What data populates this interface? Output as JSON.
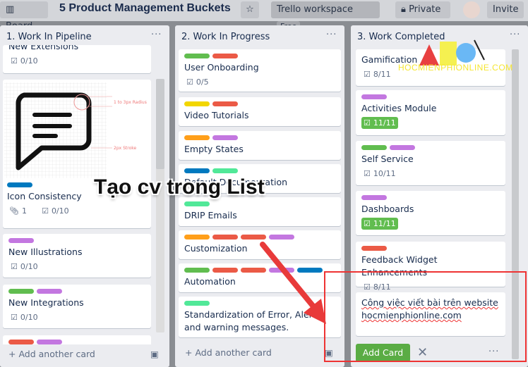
{
  "header": {
    "board_menu": "Board",
    "title": "5 Product Management Buckets",
    "workspace": "Trello workspace",
    "workspace_badge": "Free",
    "visibility": "Private",
    "invite": "Invite"
  },
  "colors": {
    "green": "#61bd4f",
    "red": "#eb5a46",
    "purple": "#c377e0",
    "blue": "#0079bf",
    "orange": "#ff9f1a",
    "yellow": "#f2d600",
    "lime": "#51e898"
  },
  "lists": [
    {
      "title": "1. Work In Pipeline",
      "add": "Add another card",
      "cards": [
        {
          "title": "New Extensions",
          "labels": [],
          "checklist": "0/10"
        },
        {
          "title": "Icon Consistency",
          "labels": [
            "blue"
          ],
          "attachments": "1",
          "checklist": "0/10",
          "cover_text": [
            "1 to 3px Radius",
            "2px Stroke"
          ]
        },
        {
          "title": "New Illustrations",
          "labels": [
            "purple"
          ],
          "checklist": "0/10"
        },
        {
          "title": "New Integrations",
          "labels": [
            "green",
            "purple"
          ],
          "checklist": "0/10"
        },
        {
          "title": "",
          "labels": [
            "red",
            "purple"
          ]
        }
      ]
    },
    {
      "title": "2. Work In Progress",
      "add": "Add another card",
      "cards": [
        {
          "title": "User Onboarding",
          "labels": [
            "green",
            "red"
          ],
          "checklist": "0/5"
        },
        {
          "title": "Video Tutorials",
          "labels": [
            "yellow",
            "red"
          ]
        },
        {
          "title": "Empty States",
          "labels": [
            "orange",
            "purple"
          ]
        },
        {
          "title": "Default Documentation",
          "labels": [
            "blue",
            "lime"
          ]
        },
        {
          "title": "DRIP Emails",
          "labels": [
            "lime"
          ]
        },
        {
          "title": "Customization",
          "labels": [
            "orange",
            "red",
            "red",
            "purple"
          ]
        },
        {
          "title": "Automation",
          "labels": [
            "green",
            "red",
            "red",
            "purple",
            "blue"
          ]
        },
        {
          "title": "Standardization of Error, Alerts, and warning messages.",
          "labels": [
            "lime"
          ]
        }
      ]
    },
    {
      "title": "3. Work Completed",
      "cards": [
        {
          "title": "Gamification",
          "labels": [],
          "checklist": "8/11"
        },
        {
          "title": "Activities Module",
          "labels": [
            "purple"
          ],
          "checklist": "11/11",
          "done": true
        },
        {
          "title": "Self Service",
          "labels": [
            "green",
            "purple"
          ],
          "checklist": "10/11"
        },
        {
          "title": "Dashboards",
          "labels": [
            "purple"
          ],
          "checklist": "11/11",
          "done": true
        },
        {
          "title": "Feedback Widget Enhancements",
          "labels": [
            "red"
          ],
          "checklist": "8/11"
        }
      ],
      "composer": {
        "value": "Công việc viết bài trên website hocmienphionline.com",
        "submit": "Add Card"
      }
    }
  ],
  "overlay": {
    "caption": "Tạo cv trong List",
    "watermark": "HOCMIENPHIONLINE.COM"
  }
}
